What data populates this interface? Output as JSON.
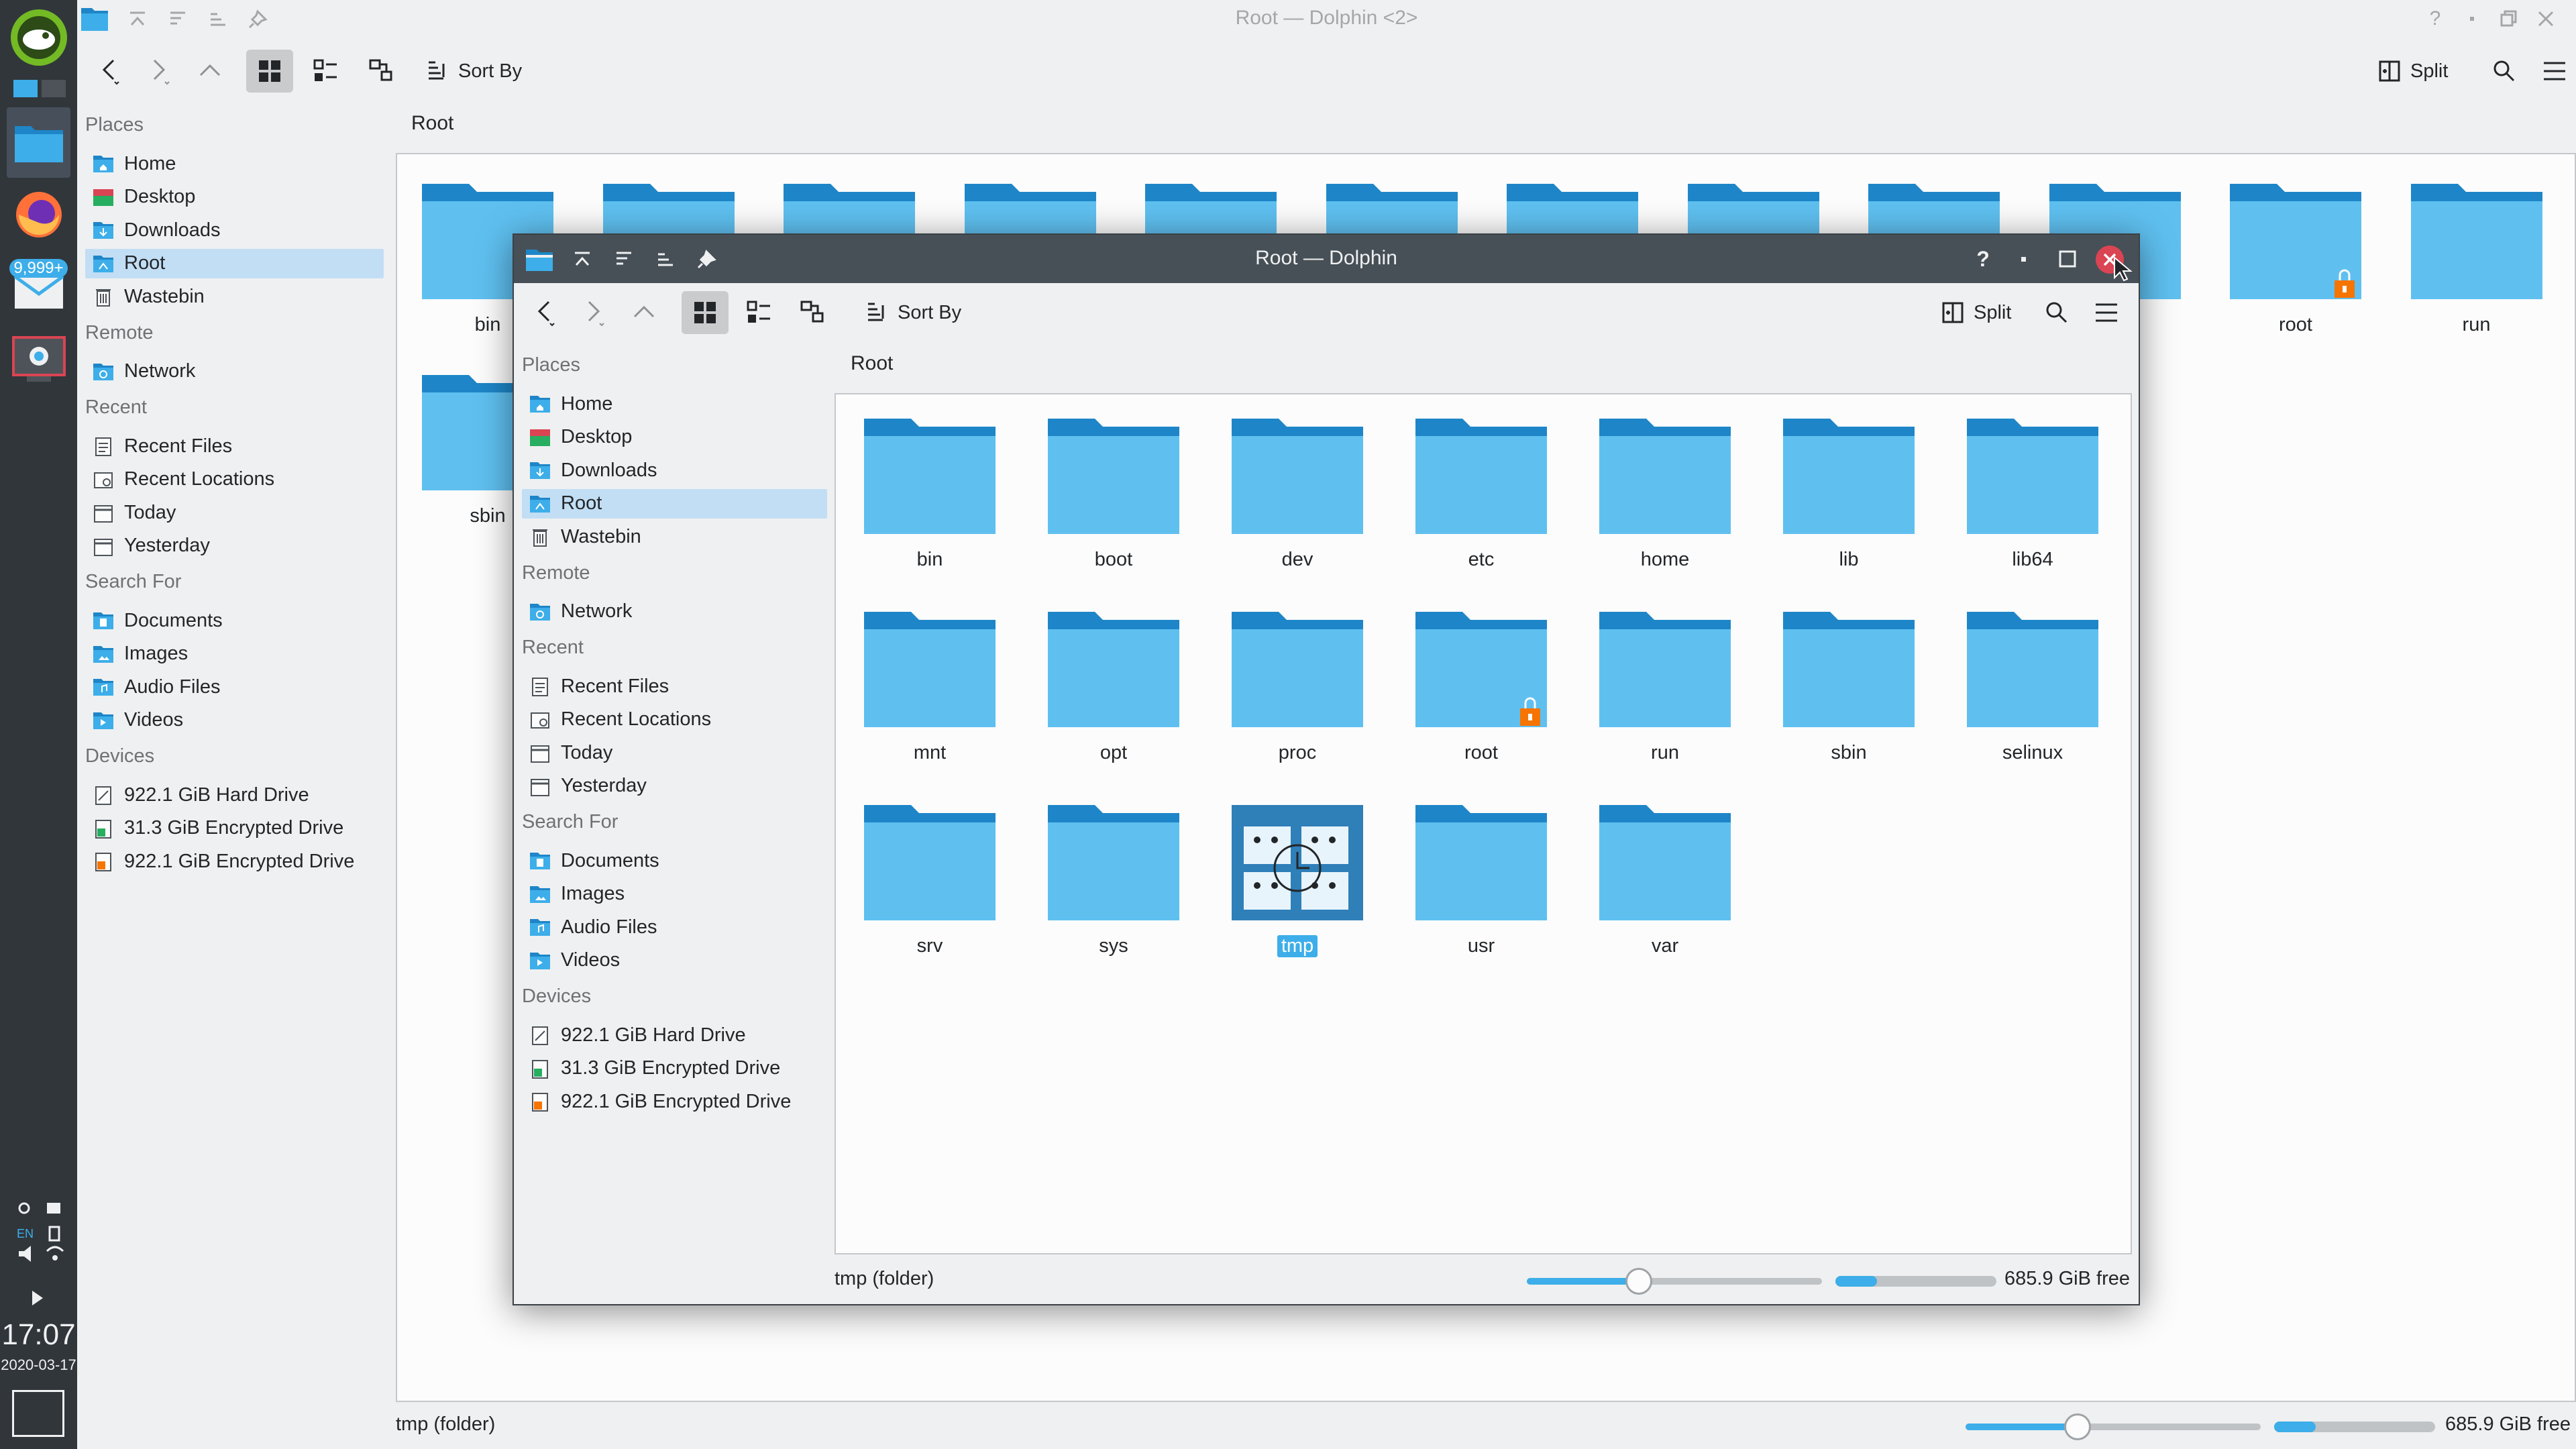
{
  "taskbar": {
    "badge": "9,999+",
    "time": "17:07",
    "date": "2020-03-17",
    "lang": "EN"
  },
  "back_window": {
    "title": "Root — Dolphin <2>",
    "toolbar": {
      "sort_by": "Sort By",
      "split": "Split"
    },
    "breadcrumb": "Root",
    "places": {
      "places_head": "Places",
      "places": [
        "Home",
        "Desktop",
        "Downloads",
        "Root",
        "Wastebin"
      ],
      "remote_head": "Remote",
      "remote": [
        "Network"
      ],
      "recent_head": "Recent",
      "recent": [
        "Recent Files",
        "Recent Locations",
        "Today",
        "Yesterday"
      ],
      "search_head": "Search For",
      "search": [
        "Documents",
        "Images",
        "Audio Files",
        "Videos"
      ],
      "devices_head": "Devices",
      "devices": [
        "922.1 GiB Hard Drive",
        "31.3 GiB Encrypted Drive",
        "922.1 GiB Encrypted Drive"
      ]
    },
    "visible_files": [
      "bin",
      "root",
      "run",
      "sbin"
    ],
    "status": "tmp (folder)",
    "free": "685.9 GiB free",
    "zoom_level": 0.38,
    "capacity_used": 0.26
  },
  "front_window": {
    "title": "Root — Dolphin",
    "toolbar": {
      "sort_by": "Sort By",
      "split": "Split"
    },
    "breadcrumb": "Root",
    "places": {
      "places_head": "Places",
      "places": [
        "Home",
        "Desktop",
        "Downloads",
        "Root",
        "Wastebin"
      ],
      "remote_head": "Remote",
      "remote": [
        "Network"
      ],
      "recent_head": "Recent",
      "recent": [
        "Recent Files",
        "Recent Locations",
        "Today",
        "Yesterday"
      ],
      "search_head": "Search For",
      "search": [
        "Documents",
        "Images",
        "Audio Files",
        "Videos"
      ],
      "devices_head": "Devices",
      "devices": [
        "922.1 GiB Hard Drive",
        "31.3 GiB Encrypted Drive",
        "922.1 GiB Encrypted Drive"
      ]
    },
    "files": [
      "bin",
      "boot",
      "dev",
      "etc",
      "home",
      "lib",
      "lib64",
      "mnt",
      "opt",
      "proc",
      "root",
      "run",
      "sbin",
      "selinux",
      "srv",
      "sys",
      "tmp",
      "usr",
      "var"
    ],
    "selected_file": "tmp",
    "locked_file": "root",
    "status": "tmp (folder)",
    "free": "685.9 GiB free",
    "zoom_level": 0.38,
    "capacity_used": 0.26
  },
  "colors": {
    "accent": "#3daee9",
    "folder_front": "#5fc0f0",
    "folder_back": "#1e86c8",
    "close_red": "#da4453",
    "lock_orange": "#f67400"
  }
}
